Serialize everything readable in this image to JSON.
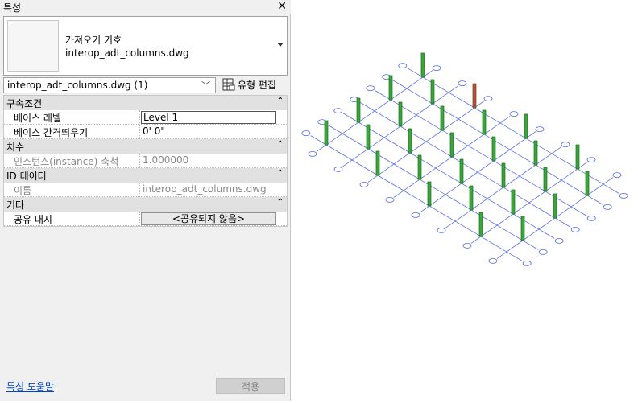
{
  "panel": {
    "title": "특성",
    "close_glyph": "✕",
    "type_selector": {
      "family": "가져오기 기호",
      "name": "interop_adt_columns.dwg"
    },
    "instance_dropdown": "interop_adt_columns.dwg (1)",
    "edit_type_label": "유형 편집",
    "categories": {
      "constraints": {
        "label": "구속조건",
        "rows": [
          {
            "key": "베이스 레벨",
            "value": "Level 1"
          },
          {
            "key": "베이스 간격띄우기",
            "value": "0'   0\""
          }
        ]
      },
      "dimensions": {
        "label": "치수",
        "rows": [
          {
            "key": "인스턴스(instance) 축척",
            "value": "1.000000"
          }
        ]
      },
      "identity": {
        "label": "ID 데이터",
        "rows": [
          {
            "key": "이름",
            "value": "interop_adt_columns.dwg"
          }
        ]
      },
      "other": {
        "label": "기타",
        "rows": [
          {
            "key": "공유 대지",
            "value": "<공유되지 않음>"
          }
        ]
      }
    },
    "help_link": "특성 도움말",
    "apply_label": "적용"
  },
  "colors": {
    "grid_line": "#5a6ee6",
    "column_fill": "#3aa63a",
    "column_stroke": "#1d6b1d",
    "selected_column": "#e23a3a"
  }
}
